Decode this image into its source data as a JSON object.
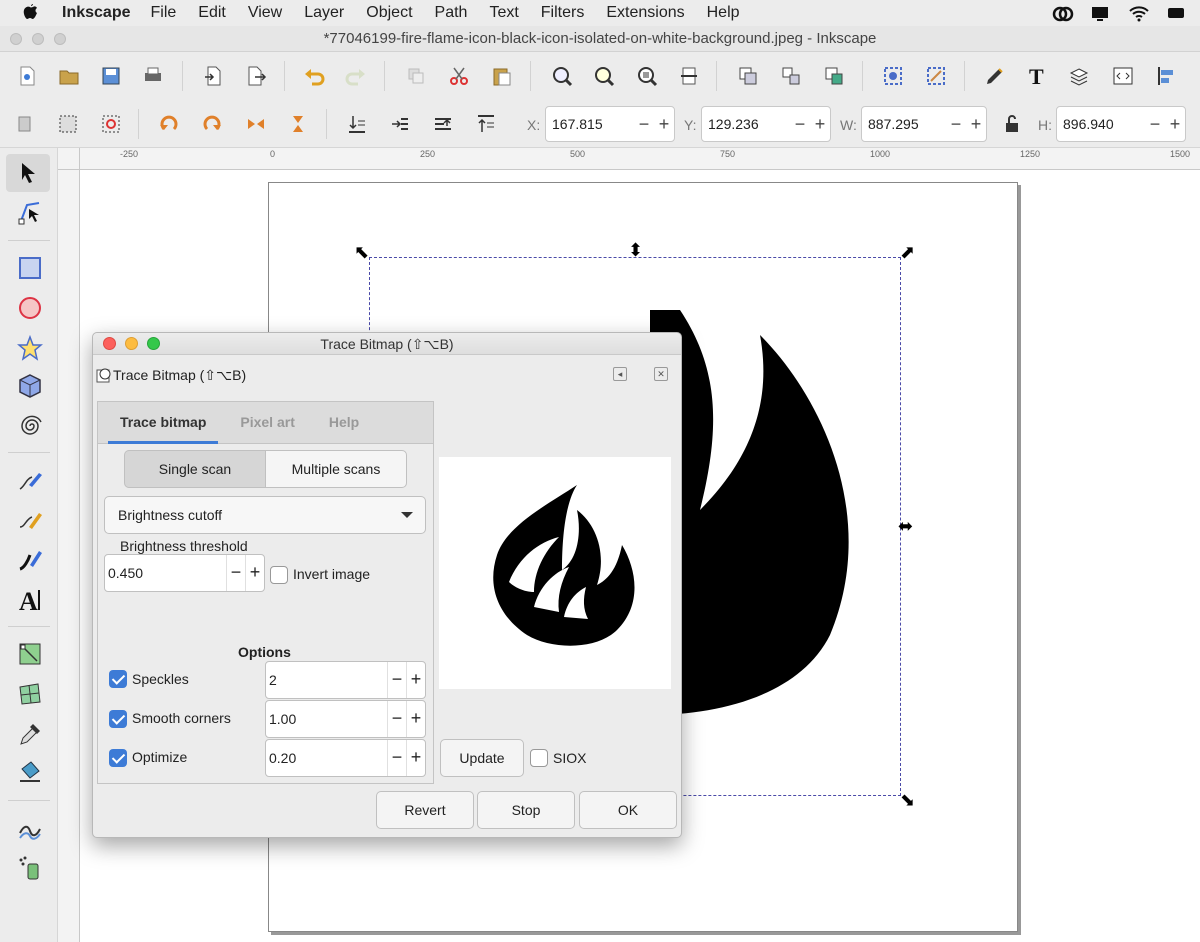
{
  "menubar": {
    "app_name": "Inkscape",
    "items": [
      "File",
      "Edit",
      "View",
      "Layer",
      "Object",
      "Path",
      "Text",
      "Filters",
      "Extensions",
      "Help"
    ]
  },
  "window": {
    "title": "*77046199-fire-flame-icon-black-icon-isolated-on-white-background.jpeg - Inkscape"
  },
  "toolcontrols": {
    "x_label": "X:",
    "x_value": "167.815",
    "y_label": "Y:",
    "y_value": "129.236",
    "w_label": "W:",
    "w_value": "887.295",
    "h_label": "H:",
    "h_value": "896.940"
  },
  "ruler": {
    "top_ticks": [
      "-250",
      "0",
      "250",
      "500",
      "750",
      "1000",
      "1250",
      "1500"
    ]
  },
  "dialog": {
    "title": "Trace Bitmap (⇧⌥B)",
    "dock_title": "Trace Bitmap (⇧⌥B)",
    "tabs": [
      "Trace bitmap",
      "Pixel art",
      "Help"
    ],
    "scan_modes": [
      "Single scan",
      "Multiple scans"
    ],
    "mode_selected": "Brightness cutoff",
    "threshold_label": "Brightness threshold",
    "threshold_value": "0.450",
    "invert_label": "Invert image",
    "options_label": "Options",
    "speckles_label": "Speckles",
    "speckles_value": "2",
    "smooth_label": "Smooth corners",
    "smooth_value": "1.00",
    "optimize_label": "Optimize",
    "optimize_value": "0.20",
    "update_label": "Update",
    "siox_label": "SIOX",
    "revert_label": "Revert",
    "stop_label": "Stop",
    "ok_label": "OK",
    "plus": "+",
    "minus": "−"
  },
  "colors": {
    "accent": "#3d7bd6",
    "selection": "#4a4aa8"
  }
}
